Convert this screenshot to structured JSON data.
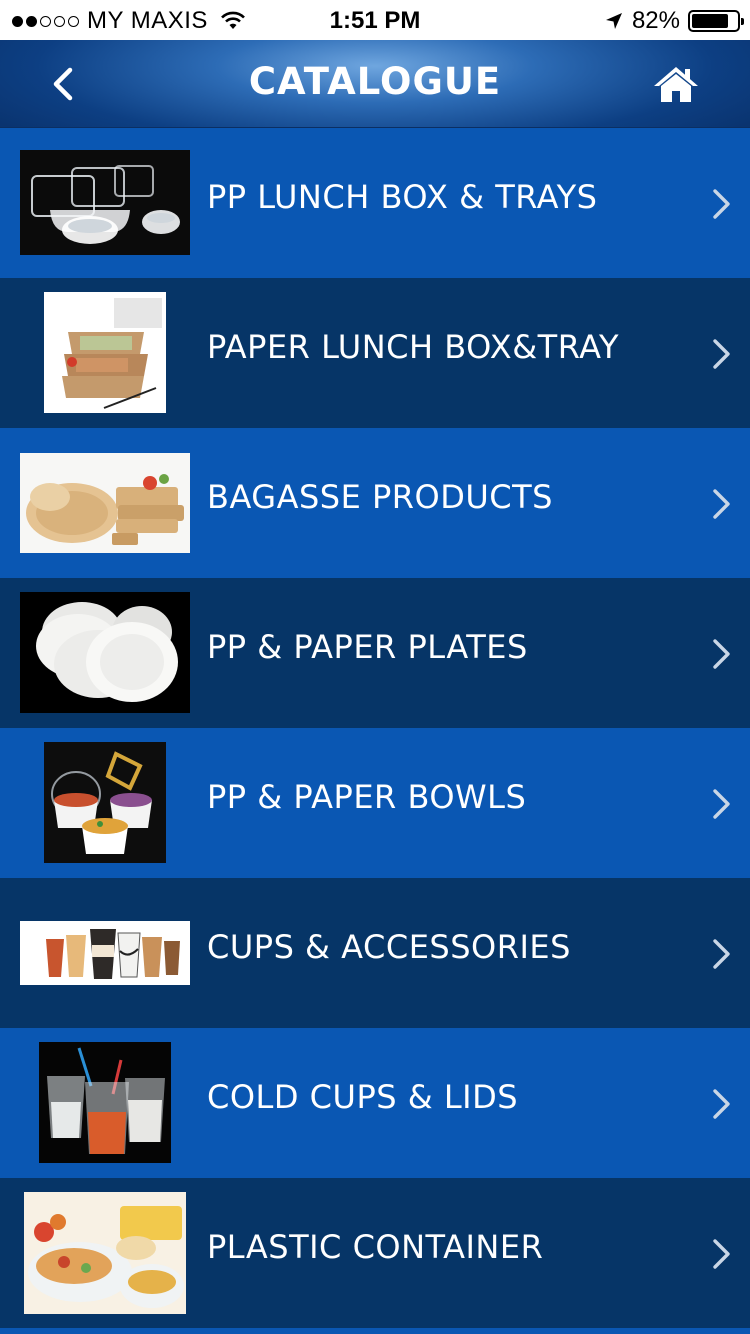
{
  "status_bar": {
    "carrier": "MY MAXIS",
    "time": "1:51 PM",
    "battery": "82%",
    "battery_level": 0.82,
    "signal_bars_filled": 2,
    "signal_bars_total": 5
  },
  "header": {
    "title": "CATALOGUE",
    "back_icon": "chevron-left-icon",
    "home_icon": "home-icon"
  },
  "colors": {
    "row_light": "#0a57b3",
    "row_dark": "#063567",
    "header_accent": "#2d6cb6"
  },
  "catalogue": {
    "items": [
      {
        "label": "PP LUNCH BOX & TRAYS"
      },
      {
        "label": "PAPER LUNCH BOX&TRAY"
      },
      {
        "label": "BAGASSE PRODUCTS"
      },
      {
        "label": "PP & PAPER PLATES"
      },
      {
        "label": "PP & PAPER BOWLS"
      },
      {
        "label": "CUPS & ACCESSORIES"
      },
      {
        "label": "COLD CUPS & LIDS"
      },
      {
        "label": "PLASTIC CONTAINER"
      }
    ]
  }
}
